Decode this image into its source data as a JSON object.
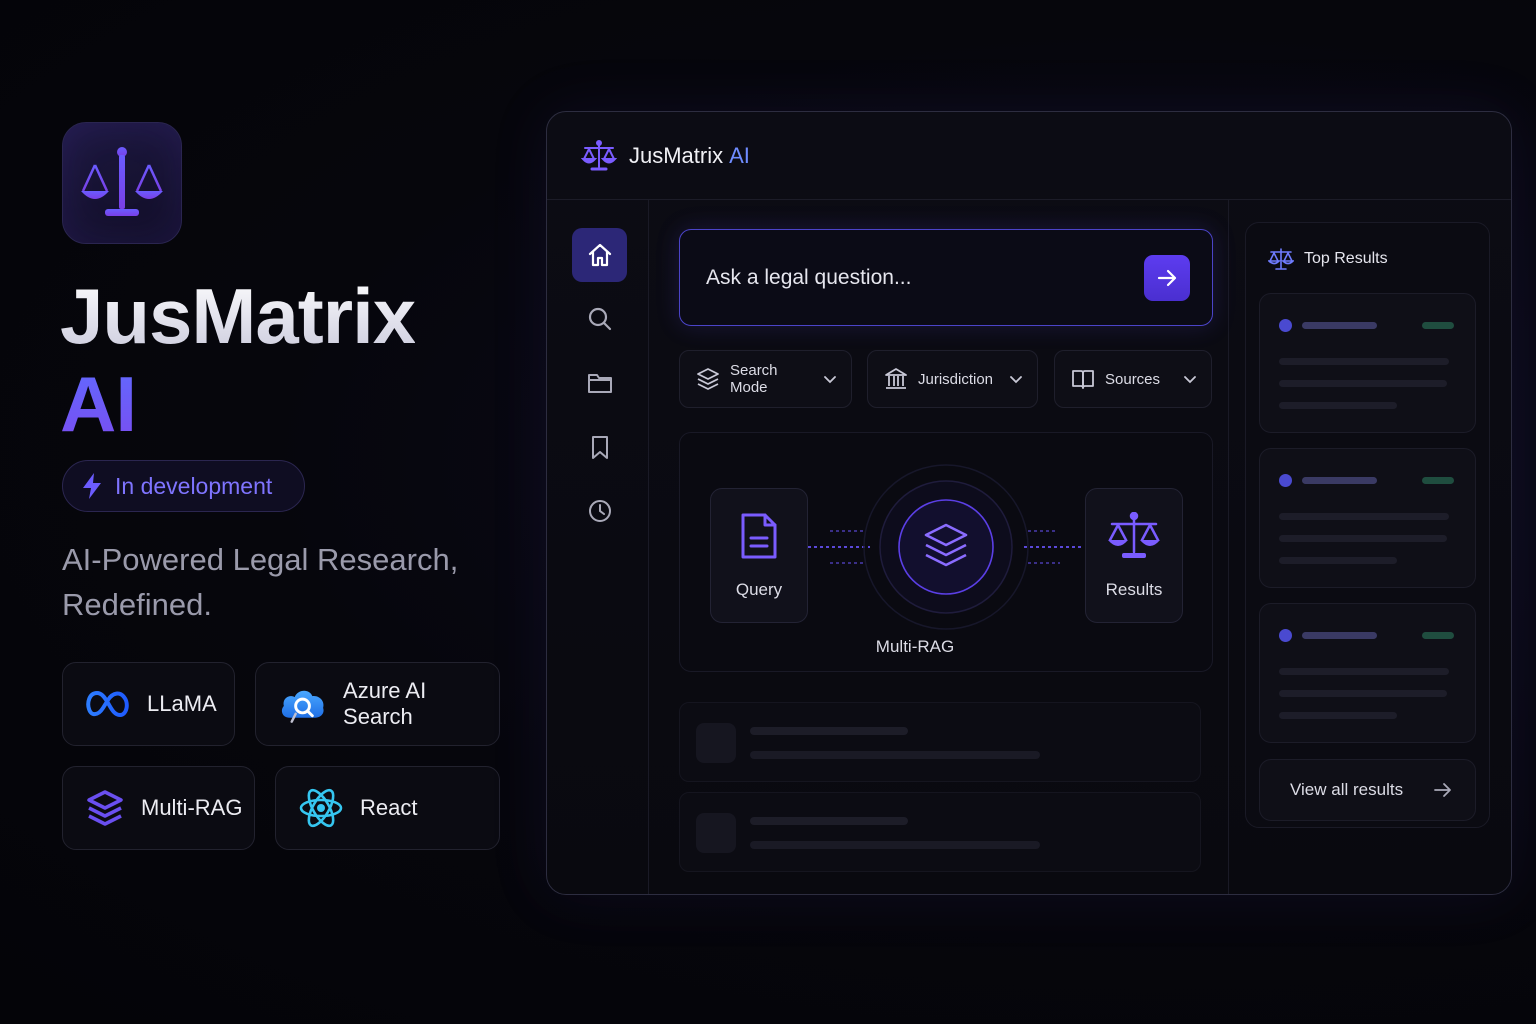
{
  "hero": {
    "title_line1": "JusMatrix",
    "title_line2": "AI",
    "badge": "In development",
    "tagline_line1": "AI-Powered Legal Research,",
    "tagline_line2": "Redefined.",
    "tech": [
      {
        "label": "LLaMA",
        "icon": "meta-infinity-icon"
      },
      {
        "label": "Azure AI Search",
        "icon": "cloud-search-icon"
      },
      {
        "label": "Multi-RAG",
        "icon": "layers-icon"
      },
      {
        "label": "React",
        "icon": "react-atom-icon"
      }
    ]
  },
  "app": {
    "brand": "JusMatrix",
    "brand_suffix": "AI",
    "nav": [
      "home-icon",
      "search-icon",
      "folder-icon",
      "bookmark-icon",
      "clock-icon"
    ],
    "search": {
      "placeholder": "Ask a legal question..."
    },
    "filters": [
      {
        "label": "Search Mode",
        "icon": "layers-icon"
      },
      {
        "label": "Jurisdiction",
        "icon": "courthouse-icon"
      },
      {
        "label": "Sources",
        "icon": "book-icon"
      }
    ],
    "flow": {
      "query_label": "Query",
      "center_label": "Multi-RAG",
      "results_label": "Results"
    },
    "results_panel": {
      "title": "Top Results",
      "view_all": "View all results"
    }
  },
  "colors": {
    "accent": "#5d3cf0",
    "accent_blue": "#6f8cff",
    "background": "#06060c"
  }
}
